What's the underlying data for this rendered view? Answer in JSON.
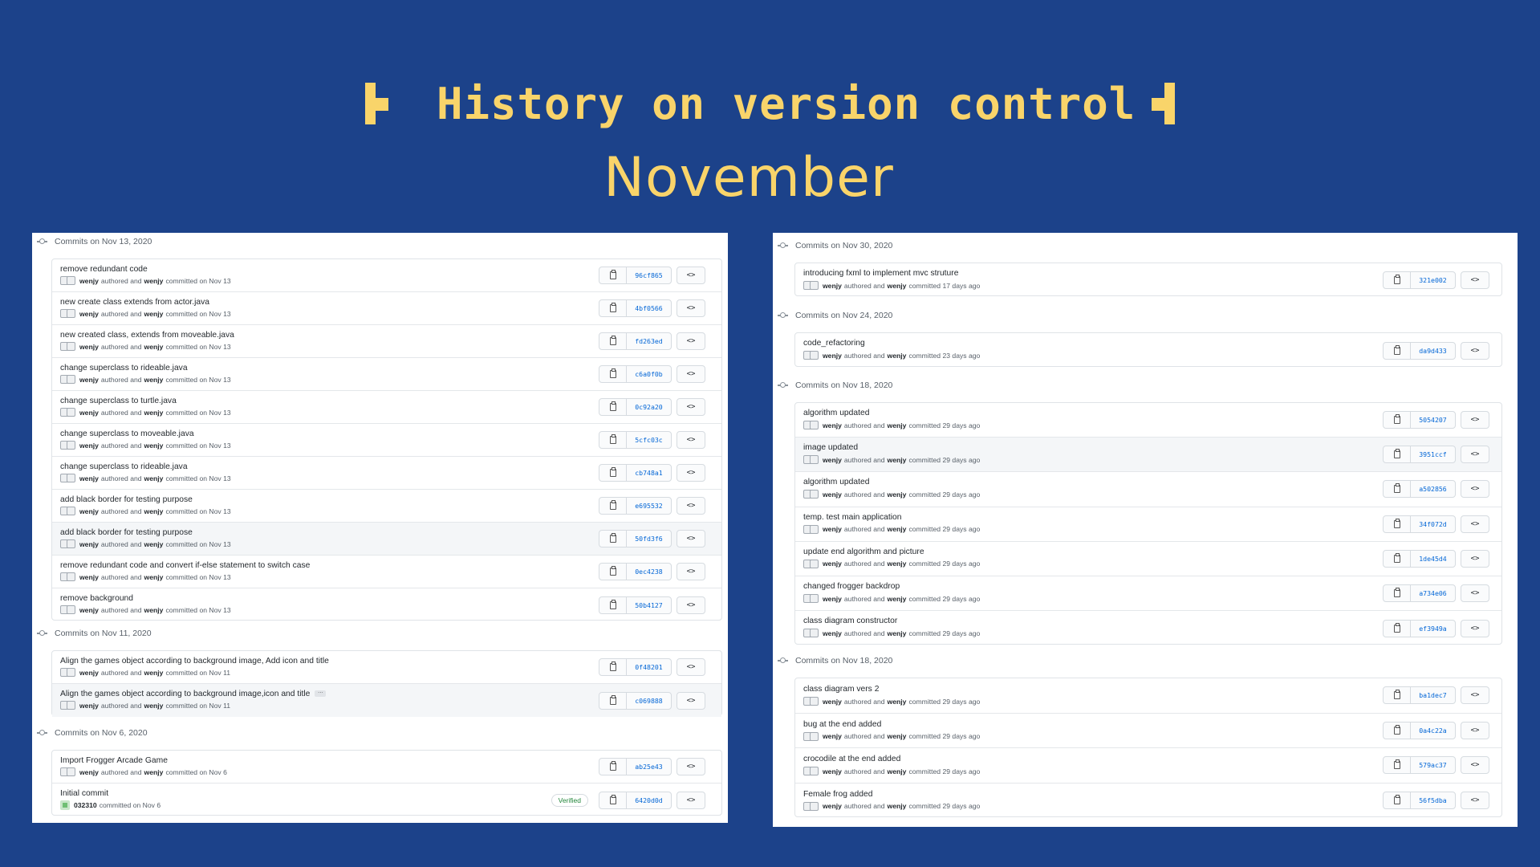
{
  "header": {
    "title": "History on version control",
    "subtitle": "November"
  },
  "icons": {
    "node": "git-commit-icon",
    "copy": "clipboard-icon",
    "browse": "code-icon",
    "avatar": "avatar-icon"
  },
  "colors": {
    "background": "#1c428a",
    "title": "#f9d46a",
    "sha": "#0366d6",
    "verified": "#22863a"
  },
  "left_panel": {
    "groups": [
      {
        "heading": "Commits on Nov 13, 2020",
        "commits": [
          {
            "message": "remove redundant code",
            "author": "wenjy",
            "authored_text": "authored and",
            "committer": "wenjy",
            "date_text": "committed on Nov 13",
            "sha": "96cf865"
          },
          {
            "message": "new create class extends from actor.java",
            "author": "wenjy",
            "authored_text": "authored and",
            "committer": "wenjy",
            "date_text": "committed on Nov 13",
            "sha": "4bf0566"
          },
          {
            "message": "new created class, extends from moveable.java",
            "author": "wenjy",
            "authored_text": "authored and",
            "committer": "wenjy",
            "date_text": "committed on Nov 13",
            "sha": "fd263ed"
          },
          {
            "message": "change superclass to rideable.java",
            "author": "wenjy",
            "authored_text": "authored and",
            "committer": "wenjy",
            "date_text": "committed on Nov 13",
            "sha": "c6a0f0b"
          },
          {
            "message": "change superclass to turtle.java",
            "author": "wenjy",
            "authored_text": "authored and",
            "committer": "wenjy",
            "date_text": "committed on Nov 13",
            "sha": "0c92a20"
          },
          {
            "message": "change superclass to moveable.java",
            "author": "wenjy",
            "authored_text": "authored and",
            "committer": "wenjy",
            "date_text": "committed on Nov 13",
            "sha": "5cfc03c"
          },
          {
            "message": "change superclass to rideable.java",
            "author": "wenjy",
            "authored_text": "authored and",
            "committer": "wenjy",
            "date_text": "committed on Nov 13",
            "sha": "cb748a1"
          },
          {
            "message": "add black border for testing purpose",
            "author": "wenjy",
            "authored_text": "authored and",
            "committer": "wenjy",
            "date_text": "committed on Nov 13",
            "sha": "e695532"
          },
          {
            "message": "add black border for testing purpose",
            "author": "wenjy",
            "authored_text": "authored and",
            "committer": "wenjy",
            "date_text": "committed on Nov 13",
            "sha": "50fd3f6"
          },
          {
            "message": "remove redundant code and convert if-else statement to switch case",
            "author": "wenjy",
            "authored_text": "authored and",
            "committer": "wenjy",
            "date_text": "committed on Nov 13",
            "sha": "0ec4238"
          },
          {
            "message": "remove background",
            "author": "wenjy",
            "authored_text": "authored and",
            "committer": "wenjy",
            "date_text": "committed on Nov 13",
            "sha": "50b4127"
          }
        ]
      },
      {
        "heading": "Commits on Nov 11, 2020",
        "commits": [
          {
            "message": "Align the games object according to background image, Add icon and title",
            "author": "wenjy",
            "authored_text": "authored and",
            "committer": "wenjy",
            "date_text": "committed on Nov 11",
            "sha": "0f48201"
          },
          {
            "message": "Align the games object according to background image,icon and title",
            "author": "wenjy",
            "authored_text": "authored and",
            "committer": "wenjy",
            "date_text": "committed on Nov 11",
            "sha": "c069888",
            "ellipsis": "…"
          }
        ]
      },
      {
        "heading": "Commits on Nov 6, 2020",
        "commits": [
          {
            "message": "Import Frogger Arcade Game",
            "author": "wenjy",
            "authored_text": "authored and",
            "committer": "wenjy",
            "date_text": "committed on Nov 6",
            "sha": "ab25e43"
          },
          {
            "message": "Initial commit",
            "author": "032310",
            "date_text": "committed on Nov 6",
            "sha": "6420d0d",
            "verified": "Verified"
          }
        ]
      }
    ]
  },
  "right_panel": {
    "groups": [
      {
        "heading": "Commits on Nov 30, 2020",
        "commits": [
          {
            "message": "introducing fxml to implement mvc struture",
            "author": "wenjy",
            "authored_text": "authored and",
            "committer": "wenjy",
            "date_text": "committed 17 days ago",
            "sha": "321e002"
          }
        ]
      },
      {
        "heading": "Commits on Nov 24, 2020",
        "commits": [
          {
            "message": "code_refactoring",
            "author": "wenjy",
            "authored_text": "authored and",
            "committer": "wenjy",
            "date_text": "committed 23 days ago",
            "sha": "da9d433"
          }
        ]
      },
      {
        "heading": "Commits on Nov 18, 2020",
        "commits": [
          {
            "message": "algorithm updated",
            "author": "wenjy",
            "authored_text": "authored and",
            "committer": "wenjy",
            "date_text": "committed 29 days ago",
            "sha": "5054207"
          },
          {
            "message": "image updated",
            "author": "wenjy",
            "authored_text": "authored and",
            "committer": "wenjy",
            "date_text": "committed 29 days ago",
            "sha": "3951ccf"
          },
          {
            "message": "algorithm updated",
            "author": "wenjy",
            "authored_text": "authored and",
            "committer": "wenjy",
            "date_text": "committed 29 days ago",
            "sha": "a502856"
          },
          {
            "message": "temp. test main application",
            "author": "wenjy",
            "authored_text": "authored and",
            "committer": "wenjy",
            "date_text": "committed 29 days ago",
            "sha": "34f072d"
          },
          {
            "message": "update end algorithm and picture",
            "author": "wenjy",
            "authored_text": "authored and",
            "committer": "wenjy",
            "date_text": "committed 29 days ago",
            "sha": "1de45d4"
          },
          {
            "message": "changed frogger backdrop",
            "author": "wenjy",
            "authored_text": "authored and",
            "committer": "wenjy",
            "date_text": "committed 29 days ago",
            "sha": "a734e06"
          },
          {
            "message": "class diagram constructor",
            "author": "wenjy",
            "authored_text": "authored and",
            "committer": "wenjy",
            "date_text": "committed 29 days ago",
            "sha": "ef3949a"
          }
        ]
      },
      {
        "heading": "Commits on Nov 18, 2020",
        "commits": [
          {
            "message": "class diagram vers 2",
            "author": "wenjy",
            "authored_text": "authored and",
            "committer": "wenjy",
            "date_text": "committed 29 days ago",
            "sha": "ba1dec7"
          },
          {
            "message": "bug at the end added",
            "author": "wenjy",
            "authored_text": "authored and",
            "committer": "wenjy",
            "date_text": "committed 29 days ago",
            "sha": "0a4c22a"
          },
          {
            "message": "crocodile at the end added",
            "author": "wenjy",
            "authored_text": "authored and",
            "committer": "wenjy",
            "date_text": "committed 29 days ago",
            "sha": "579ac37"
          },
          {
            "message": "Female frog added",
            "author": "wenjy",
            "authored_text": "authored and",
            "committer": "wenjy",
            "date_text": "committed 29 days ago",
            "sha": "56f5dba"
          }
        ]
      }
    ]
  }
}
